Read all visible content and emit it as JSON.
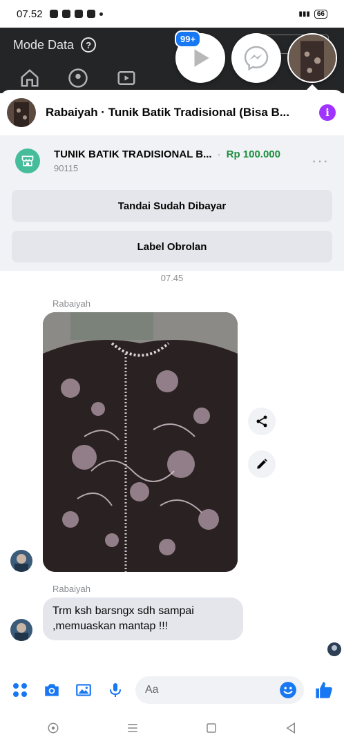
{
  "status_bar": {
    "time": "07.52",
    "battery": "66"
  },
  "background_app": {
    "mode_label": "Mode Data",
    "help_icon": "?",
    "notification_count": "99+"
  },
  "chat_heads": {
    "icons": [
      "video-play-icon",
      "messenger-icon"
    ]
  },
  "conversation": {
    "title": "Rabaiyah · Tunik Batik Tradisional (Bisa B...",
    "info_icon": "i",
    "product": {
      "name": "TUNIK BATIK TRADISIONAL B...",
      "separator": "·",
      "price": "Rp 100.000",
      "id": "90115",
      "more": "···"
    },
    "actions": {
      "mark_paid": "Tandai Sudah Dibayar",
      "label_chat": "Label Obrolan"
    },
    "timestamp": "07.45",
    "messages": [
      {
        "sender": "Rabaiyah",
        "type": "photo"
      },
      {
        "sender": "Rabaiyah",
        "type": "text",
        "text": "Trm ksh barsngx sdh sampai ,memuaskan mantap !!!"
      }
    ]
  },
  "composer": {
    "placeholder": "Aa"
  },
  "colors": {
    "accent": "#1877f2",
    "price_green": "#1e8e3e",
    "info_purple": "#a033ff",
    "shop_green": "#45bd9b"
  }
}
